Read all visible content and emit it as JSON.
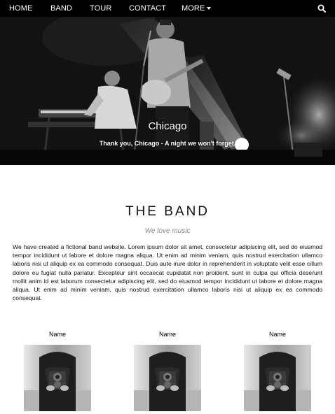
{
  "nav": {
    "items": [
      "HOME",
      "BAND",
      "TOUR",
      "CONTACT"
    ],
    "more_label": "MORE",
    "more_icon": "caret-down-icon",
    "search_icon": "search-icon"
  },
  "hero": {
    "title": "Chicago",
    "caption": "Thank you, Chicago - A night we won't forget."
  },
  "band": {
    "title": "THE BAND",
    "tagline": "We love music",
    "description": "We have created a fictional band website. Lorem ipsum dolor sit amet, consectetur adipiscing elit, sed do eiusmod tempor incididunt ut labore et dolore magna aliqua. Ut enim ad minim veniam, quis nostrud exercitation ullamco laboris nisi ut aliquip ex ea commodo consequat. Duis aute irure dolor in reprehenderit in voluptate velit esse cillum dolore eu fugiat nulla pariatur. Excepteur sint occaecat cupidatat non proident, sunt in culpa qui officia deserunt mollit anim id est laborum consectetur adipiscing elit, sed do eiusmod tempor incididunt ut labore et dolore magna aliqua. Ut enim ad minim veniam, quis nostrud exercitation ullamco laboris nisi ut aliquip ex ea commodo consequat.",
    "members": [
      {
        "name": "Name"
      },
      {
        "name": "Name"
      },
      {
        "name": "Name"
      }
    ]
  },
  "colors": {
    "nav_bg": "#000000",
    "nav_text": "#ffffff",
    "tagline": "#888888"
  }
}
